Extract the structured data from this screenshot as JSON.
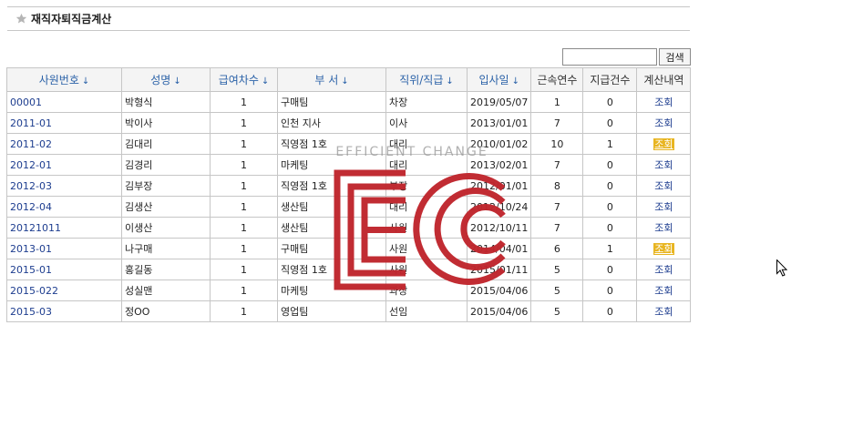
{
  "page": {
    "title": "재직자퇴직금계산",
    "star_icon": "star-icon"
  },
  "search": {
    "value": "",
    "button_label": "검색"
  },
  "table": {
    "columns": [
      {
        "label": "사원번호",
        "sortable": true
      },
      {
        "label": "성명",
        "sortable": true
      },
      {
        "label": "급여차수",
        "sortable": true
      },
      {
        "label": "부 서",
        "sortable": true
      },
      {
        "label": "직위/직급",
        "sortable": true
      },
      {
        "label": "입사일",
        "sortable": true
      },
      {
        "label": "근속연수",
        "sortable": false
      },
      {
        "label": "지급건수",
        "sortable": false
      },
      {
        "label": "계산내역",
        "sortable": false
      }
    ],
    "rows": [
      {
        "id": "00001",
        "name": "박형식",
        "pay_seq": "1",
        "dept": "구매팀",
        "position": "차장",
        "hire_date": "2019/05/07",
        "years": "1",
        "payments": "0",
        "detail": "조회",
        "highlight": false
      },
      {
        "id": "2011-01",
        "name": "박이사",
        "pay_seq": "1",
        "dept": "인천 지사",
        "position": "이사",
        "hire_date": "2013/01/01",
        "years": "7",
        "payments": "0",
        "detail": "조회",
        "highlight": false
      },
      {
        "id": "2011-02",
        "name": "김대리",
        "pay_seq": "1",
        "dept": "직영점 1호",
        "position": "대리",
        "hire_date": "2010/01/02",
        "years": "10",
        "payments": "1",
        "detail": "조회",
        "highlight": true
      },
      {
        "id": "2012-01",
        "name": "김경리",
        "pay_seq": "1",
        "dept": "마케팅",
        "position": "대리",
        "hire_date": "2013/02/01",
        "years": "7",
        "payments": "0",
        "detail": "조회",
        "highlight": false
      },
      {
        "id": "2012-03",
        "name": "김부장",
        "pay_seq": "1",
        "dept": "직영점 1호",
        "position": "부장",
        "hire_date": "2012/01/01",
        "years": "8",
        "payments": "0",
        "detail": "조회",
        "highlight": false
      },
      {
        "id": "2012-04",
        "name": "김생산",
        "pay_seq": "1",
        "dept": "생산팀",
        "position": "대리",
        "hire_date": "2012/10/24",
        "years": "7",
        "payments": "0",
        "detail": "조회",
        "highlight": false
      },
      {
        "id": "20121011",
        "name": "이생산",
        "pay_seq": "1",
        "dept": "생산팀",
        "position": "사원",
        "hire_date": "2012/10/11",
        "years": "7",
        "payments": "0",
        "detail": "조회",
        "highlight": false
      },
      {
        "id": "2013-01",
        "name": "나구매",
        "pay_seq": "1",
        "dept": "구매팀",
        "position": "사원",
        "hire_date": "2014/04/01",
        "years": "6",
        "payments": "1",
        "detail": "조회",
        "highlight": true
      },
      {
        "id": "2015-01",
        "name": "홍길동",
        "pay_seq": "1",
        "dept": "직영점 1호",
        "position": "사원",
        "hire_date": "2015/01/11",
        "years": "5",
        "payments": "0",
        "detail": "조회",
        "highlight": false
      },
      {
        "id": "2015-022",
        "name": "성실맨",
        "pay_seq": "1",
        "dept": "마케팅",
        "position": "과장",
        "hire_date": "2015/04/06",
        "years": "5",
        "payments": "0",
        "detail": "조회",
        "highlight": false
      },
      {
        "id": "2015-03",
        "name": "정OO",
        "pay_seq": "1",
        "dept": "영업팀",
        "position": "선임",
        "hire_date": "2015/04/06",
        "years": "5",
        "payments": "0",
        "detail": "조회",
        "highlight": false
      }
    ]
  },
  "watermark": {
    "text": "EFFICIENT CHANGE",
    "logo_icon": "ec-logo",
    "color": "#c0262d"
  },
  "colors": {
    "link": "#1d3d8f",
    "sort_header": "#2b62a8",
    "highlight": "#e8b521"
  }
}
